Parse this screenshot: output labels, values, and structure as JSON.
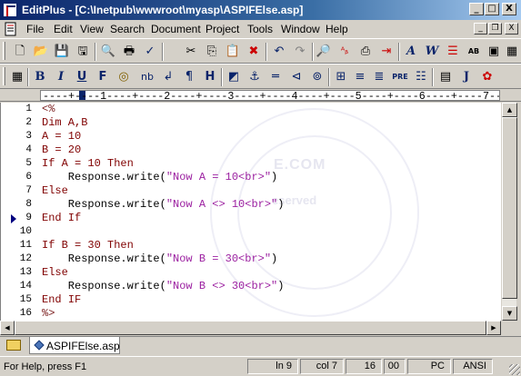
{
  "window": {
    "title": "EditPlus - [C:\\Inetpub\\wwwroot\\myasp\\ASPIFElse.asp]",
    "minimize_glyph": "_",
    "maximize_glyph": "□",
    "close_glyph": "X"
  },
  "menu": {
    "items": [
      "File",
      "Edit",
      "View",
      "Search",
      "Document",
      "Project",
      "Tools",
      "Window",
      "Help"
    ],
    "mdi_minimize": "_",
    "mdi_restore": "❐",
    "mdi_close": "X"
  },
  "toolbar1": {
    "buttons": [
      {
        "icon": "new-file-icon",
        "glyph": "🗋"
      },
      {
        "icon": "open-folder-icon",
        "glyph": "📂"
      },
      {
        "icon": "save-icon",
        "glyph": "💾"
      },
      {
        "icon": "save-all-icon",
        "glyph": "🖫"
      },
      {
        "icon": "print-preview-icon",
        "glyph": "🔍"
      },
      {
        "icon": "print-icon",
        "glyph": "🖶"
      },
      {
        "icon": "spell-check-icon",
        "glyph": "✓"
      },
      {
        "icon": "cut-icon",
        "glyph": "✂"
      },
      {
        "icon": "copy-icon",
        "glyph": "⎘"
      },
      {
        "icon": "paste-icon",
        "glyph": "📋"
      },
      {
        "icon": "delete-icon",
        "glyph": "✖"
      },
      {
        "icon": "undo-icon",
        "glyph": "↶"
      },
      {
        "icon": "redo-icon",
        "glyph": "↷"
      },
      {
        "icon": "find-icon",
        "glyph": "🔎"
      },
      {
        "icon": "replace-icon",
        "glyph": "ᴬᵦ"
      },
      {
        "icon": "goto-icon",
        "glyph": "⎙"
      },
      {
        "icon": "indent-icon",
        "glyph": "⇥"
      },
      {
        "icon": "font-icon",
        "glyph": "A"
      },
      {
        "icon": "word-wrap-icon",
        "glyph": "W"
      },
      {
        "icon": "line-number-icon",
        "glyph": "☰"
      },
      {
        "icon": "column-icon",
        "glyph": "AB"
      },
      {
        "icon": "window-icon",
        "glyph": "▣"
      },
      {
        "icon": "properties-icon",
        "glyph": "▦"
      }
    ]
  },
  "toolbar2": {
    "buttons": [
      {
        "icon": "browser-preview-icon",
        "glyph": "▦"
      },
      {
        "icon": "bold-icon",
        "glyph": "B"
      },
      {
        "icon": "italic-icon",
        "glyph": "I"
      },
      {
        "icon": "underline-icon",
        "glyph": "U"
      },
      {
        "icon": "font-tag-icon",
        "glyph": "F"
      },
      {
        "icon": "color-icon",
        "glyph": "◎"
      },
      {
        "icon": "nbsp-icon",
        "glyph": "nb"
      },
      {
        "icon": "line-break-icon",
        "glyph": "↲"
      },
      {
        "icon": "paragraph-icon",
        "glyph": "¶"
      },
      {
        "icon": "heading-icon",
        "glyph": "H"
      },
      {
        "icon": "image-icon",
        "glyph": "◩"
      },
      {
        "icon": "anchor-icon",
        "glyph": "⚓"
      },
      {
        "icon": "hr-icon",
        "glyph": "═"
      },
      {
        "icon": "comment-icon",
        "glyph": "⊲"
      },
      {
        "icon": "target-icon",
        "glyph": "⊚"
      },
      {
        "icon": "table-icon",
        "glyph": "⊞"
      },
      {
        "icon": "center-icon",
        "glyph": "≡"
      },
      {
        "icon": "align-icon",
        "glyph": "≣"
      },
      {
        "icon": "pre-icon",
        "glyph": "PRE"
      },
      {
        "icon": "list-icon",
        "glyph": "☷"
      },
      {
        "icon": "form-icon",
        "glyph": "▤"
      },
      {
        "icon": "javascript-icon",
        "glyph": "J"
      },
      {
        "icon": "plugin-icon",
        "glyph": "✿"
      }
    ]
  },
  "ruler": {
    "text": "----+----1----+----2----+----3----+----4----+----5----+----6----+----7--"
  },
  "editor": {
    "lines": [
      {
        "n": "1",
        "parts": [
          {
            "t": "<%",
            "c": "asp"
          }
        ]
      },
      {
        "n": "2",
        "parts": [
          {
            "t": "Dim A,B",
            "c": "kw"
          }
        ]
      },
      {
        "n": "3",
        "parts": [
          {
            "t": "A = 10",
            "c": "kw"
          }
        ]
      },
      {
        "n": "4",
        "parts": [
          {
            "t": "B = 20",
            "c": "kw"
          }
        ]
      },
      {
        "n": "5",
        "parts": [
          {
            "t": "If A = 10 Then",
            "c": "kw"
          }
        ]
      },
      {
        "n": "6",
        "parts": [
          {
            "t": "    Response.write(",
            "c": "plain"
          },
          {
            "t": "\"Now A = 10<br>\"",
            "c": "str"
          },
          {
            "t": ")",
            "c": "plain"
          }
        ]
      },
      {
        "n": "7",
        "parts": [
          {
            "t": "Else",
            "c": "kw"
          }
        ]
      },
      {
        "n": "8",
        "parts": [
          {
            "t": "    Response.write(",
            "c": "plain"
          },
          {
            "t": "\"Now A <> 10<br>\"",
            "c": "str"
          },
          {
            "t": ")",
            "c": "plain"
          }
        ]
      },
      {
        "n": "9",
        "parts": [
          {
            "t": "End If",
            "c": "kw"
          }
        ]
      },
      {
        "n": "10",
        "parts": []
      },
      {
        "n": "11",
        "parts": [
          {
            "t": "If B = 30 Then",
            "c": "kw"
          }
        ]
      },
      {
        "n": "12",
        "parts": [
          {
            "t": "    Response.write(",
            "c": "plain"
          },
          {
            "t": "\"Now B = 30<br>\"",
            "c": "str"
          },
          {
            "t": ")",
            "c": "plain"
          }
        ]
      },
      {
        "n": "13",
        "parts": [
          {
            "t": "Else",
            "c": "kw"
          }
        ]
      },
      {
        "n": "14",
        "parts": [
          {
            "t": "    Response.write(",
            "c": "plain"
          },
          {
            "t": "\"Now B <> 30<br>\"",
            "c": "str"
          },
          {
            "t": ")",
            "c": "plain"
          }
        ]
      },
      {
        "n": "15",
        "parts": [
          {
            "t": "End IF",
            "c": "kw"
          }
        ]
      },
      {
        "n": "16",
        "parts": [
          {
            "t": "%>",
            "c": "asp"
          }
        ]
      }
    ],
    "current_line_marker": "9",
    "watermark_text": "E.COM",
    "watermark_text2": "eserved"
  },
  "scroll": {
    "up_glyph": "▲",
    "down_glyph": "▼",
    "left_glyph": "◀",
    "right_glyph": "▶"
  },
  "filetabs": {
    "active": "ASPIFElse.asp"
  },
  "status": {
    "help": "For Help, press F1",
    "line": "ln 9",
    "col": "col 7",
    "num": "16",
    "code": "00",
    "mode": "PC",
    "encoding": "ANSI"
  },
  "colors": {
    "keyword": "#800000",
    "string": "#9b1fa0",
    "titlebar": "#0a246a"
  }
}
